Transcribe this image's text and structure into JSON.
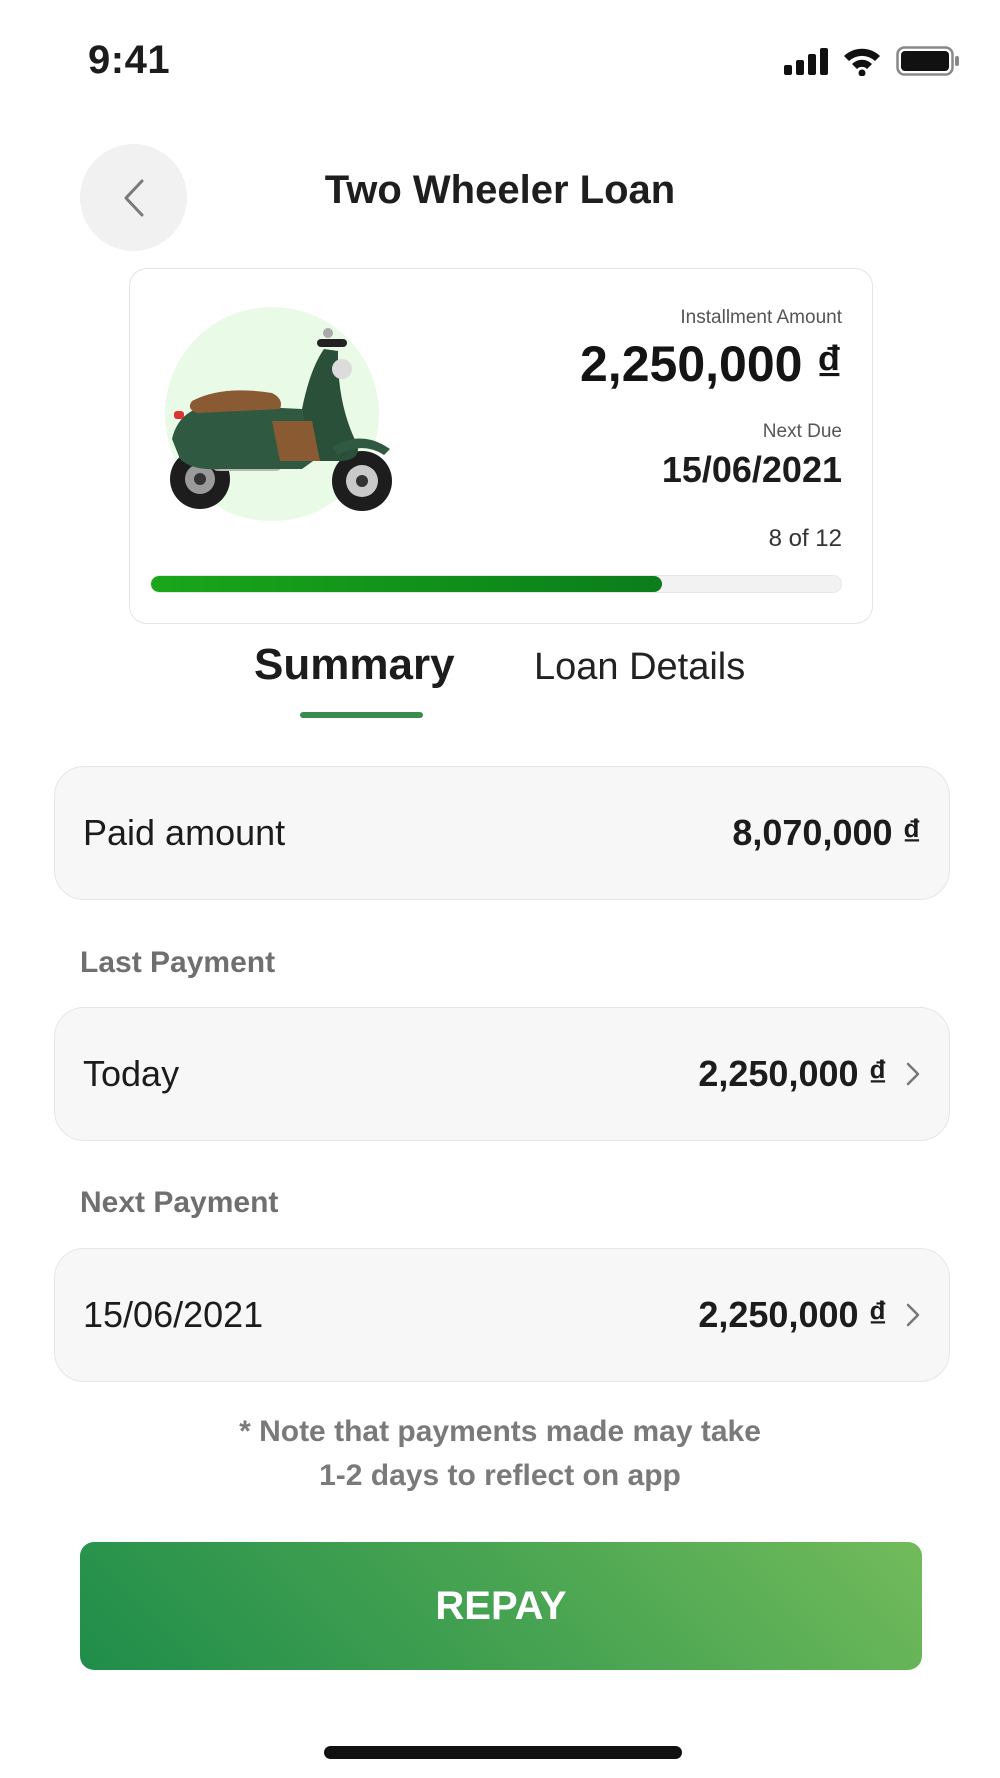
{
  "status_bar": {
    "time": "9:41",
    "icons": [
      "cellular-signal-icon",
      "wifi-icon",
      "battery-icon"
    ]
  },
  "header": {
    "title": "Two Wheeler Loan",
    "back_icon": "chevron-left-icon"
  },
  "loan_card": {
    "installment_label": "Installment Amount",
    "installment_amount": "2,250,000 ₫",
    "next_due_label": "Next Due",
    "next_due_date": "15/06/2021",
    "progress_text": "8 of 12",
    "progress_fraction": 0.74,
    "accent_color": "#0b7d1b"
  },
  "tabs": [
    {
      "label": "Summary",
      "active": true
    },
    {
      "label": "Loan Details",
      "active": false
    }
  ],
  "summary": {
    "paid_amount_label": "Paid amount",
    "paid_amount_value": "8,070,000 ₫",
    "last_payment_heading": "Last Payment",
    "last_payment_label": "Today",
    "last_payment_value": "2,250,000 ₫",
    "next_payment_heading": "Next Payment",
    "next_payment_label": "15/06/2021",
    "next_payment_value": "2,250,000 ₫"
  },
  "note": {
    "line1": "* Note that payments made may take",
    "line2": "1-2 days to reflect on app"
  },
  "repay_button": {
    "label": "REPAY",
    "color": "#2e9a4e"
  }
}
